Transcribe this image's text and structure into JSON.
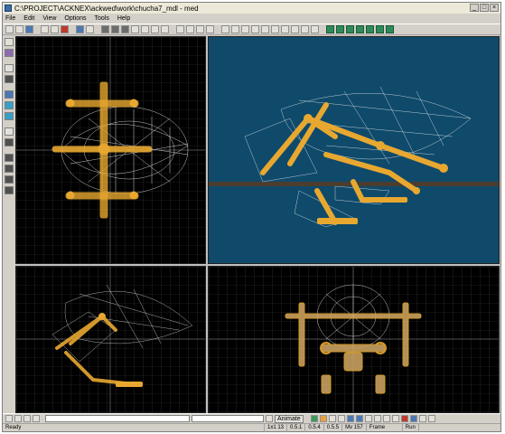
{
  "window": {
    "title": "C:\\PROJECT\\ACKNEX\\ackwed\\work\\chucha7_mdl - med",
    "minimize": "_",
    "maximize": "□",
    "close": "×"
  },
  "menu": [
    "File",
    "Edit",
    "View",
    "Options",
    "Tools",
    "Help"
  ],
  "bottom": {
    "animate_label": "Animate"
  },
  "status": {
    "ready": "Ready",
    "fields": [
      "1x1 13",
      "0.5.1",
      "0.5.4",
      "0.5.5",
      "Mv 157",
      "Frame",
      "Run"
    ]
  },
  "colors": {
    "viewport_bg": "#000000",
    "perspective_bg": "#0f4a6b",
    "grid": "#3a3a3a",
    "bone": "#e8a830",
    "mesh": "#e8e8e8"
  }
}
